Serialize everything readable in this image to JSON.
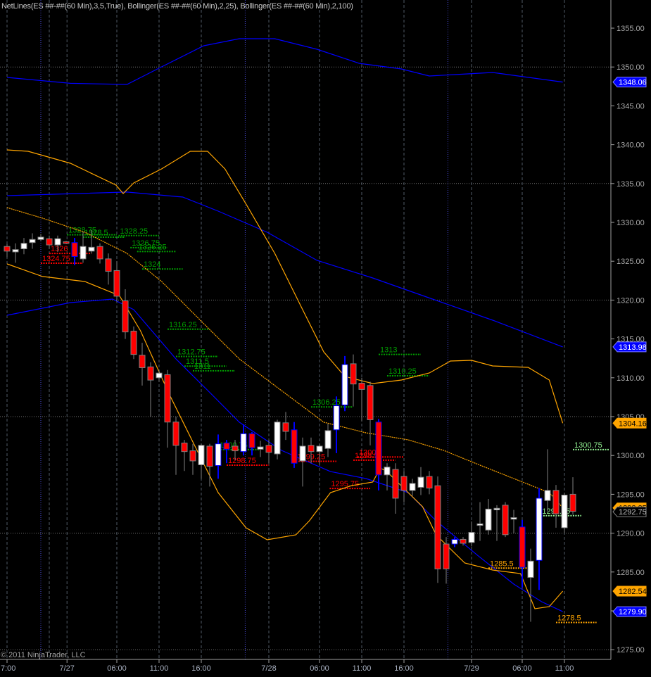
{
  "chart_data": {
    "type": "candlestick",
    "title": "NetLines(ES ##-##(60 Min),3,5,True), Bollinger(ES ##-##(60 Min),2,25), Bollinger(ES ##-##(60 Min),2,100)",
    "copyright": "© 2011 NinjaTrader, LLC",
    "ylim": [
      1273.4,
      1358.6
    ],
    "y_ticks": [
      1275,
      1280,
      1285,
      1290,
      1295,
      1300,
      1305,
      1310,
      1315,
      1320,
      1325,
      1330,
      1335,
      1340,
      1345,
      1350,
      1355
    ],
    "y_grid": [
      1275,
      1290,
      1305,
      1320,
      1335,
      1350
    ],
    "x_ticks": [
      {
        "bar": 0,
        "label": "7:00"
      },
      {
        "bar": 7.1,
        "label": "7/27"
      },
      {
        "bar": 13,
        "label": "06:00"
      },
      {
        "bar": 18,
        "label": "11:00"
      },
      {
        "bar": 23,
        "label": "16:00"
      },
      {
        "bar": 31,
        "label": "7/28"
      },
      {
        "bar": 37,
        "label": "06:00"
      },
      {
        "bar": 42,
        "label": "11:00"
      },
      {
        "bar": 47,
        "label": "16:00"
      },
      {
        "bar": 55,
        "label": "7/29"
      },
      {
        "bar": 61,
        "label": "06:00"
      },
      {
        "bar": 66,
        "label": "11:00"
      }
    ],
    "grid_bars": [
      0,
      5,
      7.1,
      13,
      18,
      23,
      31,
      37,
      42,
      47,
      55,
      61,
      66
    ],
    "session_bars": [
      4,
      28.2,
      52.2
    ],
    "colors": {
      "up": "#ffffff",
      "down": "#ff0000",
      "wick": "#808080",
      "signal": "#0000ff",
      "bb25": "#ffa500",
      "bb100": "#0000ff"
    },
    "candles": [
      [
        1326.9,
        1327.2,
        1325.5,
        1326.3,
        "d"
      ],
      [
        1326.2,
        1327.3,
        1324.8,
        1326.5,
        "u"
      ],
      [
        1326.6,
        1328.0,
        1325.9,
        1327.3,
        "u"
      ],
      [
        1327.4,
        1328.6,
        1326.6,
        1327.8,
        "u"
      ],
      [
        1327.8,
        1328.5,
        1327.6,
        1328.1,
        "u"
      ],
      [
        1327.9,
        1328.3,
        1326.6,
        1327.1,
        "d"
      ],
      [
        1327.1,
        1328.3,
        1326.2,
        1327.9,
        "u"
      ],
      [
        1327.5,
        1327.6,
        1327.2,
        1327.3,
        "d"
      ],
      [
        1327.4,
        1328.0,
        1324.5,
        1325.6,
        "bd"
      ],
      [
        1325.3,
        1328.8,
        1324.8,
        1326.9,
        "u"
      ],
      [
        1326.3,
        1329.0,
        1326.0,
        1326.8,
        "u"
      ],
      [
        1326.9,
        1327.3,
        1324.7,
        1325.3,
        "d"
      ],
      [
        1325.3,
        1326.0,
        1322.0,
        1323.7,
        "d"
      ],
      [
        1323.8,
        1325.0,
        1319.8,
        1320.5,
        "d"
      ],
      [
        1319.9,
        1321.4,
        1315.0,
        1315.9,
        "d"
      ],
      [
        1316.0,
        1316.6,
        1312.4,
        1313.0,
        "d"
      ],
      [
        1312.9,
        1314.5,
        1309.0,
        1311.3,
        "d"
      ],
      [
        1311.4,
        1312.0,
        1305.0,
        1309.7,
        "d"
      ],
      [
        1310.0,
        1311.0,
        1309.5,
        1310.6,
        "u"
      ],
      [
        1310.4,
        1311.0,
        1301.0,
        1304.3,
        "d"
      ],
      [
        1304.3,
        1305.0,
        1297.5,
        1301.3,
        "d"
      ],
      [
        1301.6,
        1302.0,
        1298.0,
        1300.5,
        "d"
      ],
      [
        1300.6,
        1301.5,
        1297.5,
        1299.3,
        "d"
      ],
      [
        1298.8,
        1301.5,
        1297.0,
        1301.3,
        "u"
      ],
      [
        1301.2,
        1301.5,
        1296.0,
        1298.6,
        "d"
      ],
      [
        1298.7,
        1302.7,
        1297.0,
        1301.5,
        "bu"
      ],
      [
        1301.6,
        1302.0,
        1299.0,
        1300.8,
        "bd"
      ],
      [
        1301.2,
        1302.0,
        1299.4,
        1300.6,
        "d"
      ],
      [
        1300.5,
        1304.0,
        1300.0,
        1302.8,
        "bu"
      ],
      [
        1302.8,
        1303.0,
        1300.0,
        1301.0,
        "bd"
      ],
      [
        1300.8,
        1301.9,
        1299.8,
        1301.1,
        "u"
      ],
      [
        1301.3,
        1302.0,
        1299.0,
        1300.4,
        "d"
      ],
      [
        1300.2,
        1304.6,
        1299.5,
        1304.3,
        "u"
      ],
      [
        1304.2,
        1305.6,
        1302.0,
        1303.1,
        "d"
      ],
      [
        1303.3,
        1304.3,
        1298.4,
        1299.0,
        "bd"
      ],
      [
        1299.3,
        1302.3,
        1296.0,
        1301.2,
        "u"
      ],
      [
        1301.3,
        1302.3,
        1299.0,
        1300.5,
        "d"
      ],
      [
        1300.5,
        1301.5,
        1298.8,
        1301.2,
        "u"
      ],
      [
        1300.9,
        1304.1,
        1299.8,
        1303.2,
        "u"
      ],
      [
        1303.3,
        1307.6,
        1300.3,
        1306.4,
        "bu"
      ],
      [
        1306.5,
        1312.8,
        1305.7,
        1311.7,
        "bu"
      ],
      [
        1311.8,
        1313.0,
        1306.3,
        1309.2,
        "d"
      ],
      [
        1309.3,
        1310.0,
        1304.4,
        1308.5,
        "d"
      ],
      [
        1309.0,
        1309.5,
        1301.3,
        1304.6,
        "d"
      ],
      [
        1304.3,
        1304.7,
        1295.5,
        1297.5,
        "bd"
      ],
      [
        1297.5,
        1299.0,
        1295.5,
        1298.5,
        "u"
      ],
      [
        1298.2,
        1299.0,
        1292.5,
        1294.5,
        "d"
      ],
      [
        1297.3,
        1298.0,
        1294.0,
        1295.5,
        "d"
      ],
      [
        1295.5,
        1297.0,
        1294.8,
        1296.4,
        "u"
      ],
      [
        1295.9,
        1298.5,
        1294.9,
        1297.2,
        "u"
      ],
      [
        1297.3,
        1298.0,
        1295.0,
        1295.8,
        "d"
      ],
      [
        1296.1,
        1297.3,
        1283.6,
        1285.4,
        "d"
      ],
      [
        1288.6,
        1289.5,
        1283.5,
        1285.4,
        "d"
      ],
      [
        1288.6,
        1289.5,
        1288.2,
        1289.2,
        "bu"
      ],
      [
        1289.2,
        1289.5,
        1288.4,
        1288.7,
        "d"
      ],
      [
        1288.8,
        1291.5,
        1288.3,
        1290.1,
        "u"
      ],
      [
        1291.0,
        1294.0,
        1289.0,
        1291.2,
        "u"
      ],
      [
        1290.4,
        1294.4,
        1289.8,
        1293.1,
        "u"
      ],
      [
        1293.0,
        1293.6,
        1289.0,
        1293.2,
        "u"
      ],
      [
        1293.6,
        1294.0,
        1289.5,
        1289.8,
        "d"
      ],
      [
        1291.8,
        1293.0,
        1290.0,
        1292.0,
        "u"
      ],
      [
        1290.8,
        1291.7,
        1283.0,
        1285.6,
        "bd"
      ],
      [
        1284.3,
        1288.0,
        1278.6,
        1286.4,
        "u"
      ],
      [
        1286.5,
        1295.8,
        1282.7,
        1294.5,
        "bu"
      ],
      [
        1294.2,
        1300.8,
        1292.8,
        1295.5,
        "u"
      ],
      [
        1295.5,
        1296.2,
        1290.7,
        1292.5,
        "d"
      ],
      [
        1290.7,
        1295.2,
        1290.0,
        1294.9,
        "u"
      ],
      [
        1295.0,
        1297.2,
        1292.4,
        1292.8,
        "d"
      ]
    ],
    "series": [
      {
        "name": "Bollinger(100) upper",
        "color": "#0000ff",
        "dash": "",
        "points": [
          [
            0,
            1348.66
          ],
          [
            7.5,
            1347.9
          ],
          [
            14.2,
            1347.75
          ],
          [
            18.3,
            1350.02
          ],
          [
            23.3,
            1352.74
          ],
          [
            27.5,
            1353.64
          ],
          [
            31.7,
            1353.64
          ],
          [
            36.7,
            1352.28
          ],
          [
            41.7,
            1350.47
          ],
          [
            46.7,
            1349.75
          ],
          [
            50,
            1348.84
          ],
          [
            57.5,
            1349.29
          ],
          [
            65.8,
            1348.06
          ]
        ]
      },
      {
        "name": "Bollinger(100) middle",
        "color": "#0000ff",
        "dash": "",
        "points": [
          [
            0,
            1333.44
          ],
          [
            14.2,
            1333.9
          ],
          [
            20.8,
            1333.26
          ],
          [
            25,
            1331.45
          ],
          [
            30.8,
            1328.73
          ],
          [
            36.7,
            1325.11
          ],
          [
            43.3,
            1322.84
          ],
          [
            49.2,
            1320.58
          ],
          [
            57.5,
            1317.41
          ],
          [
            65.8,
            1313.98
          ]
        ]
      },
      {
        "name": "Bollinger(100) lower",
        "color": "#0000ff",
        "dash": "",
        "points": [
          [
            0,
            1318.04
          ],
          [
            7.5,
            1319.67
          ],
          [
            12.5,
            1320.13
          ],
          [
            15,
            1318.77
          ],
          [
            20,
            1312.43
          ],
          [
            24.2,
            1307.9
          ],
          [
            27.5,
            1304.28
          ],
          [
            32.5,
            1300.65
          ],
          [
            38.3,
            1297.93
          ],
          [
            42.5,
            1297.03
          ],
          [
            47.5,
            1295.22
          ],
          [
            50.8,
            1291.59
          ],
          [
            55.8,
            1287.07
          ],
          [
            60,
            1283.44
          ],
          [
            63.3,
            1281.18
          ],
          [
            65.8,
            1279.9
          ]
        ]
      },
      {
        "name": "Bollinger(25) upper",
        "color": "#ffa500",
        "dash": "",
        "points": [
          [
            0,
            1339.33
          ],
          [
            2.5,
            1339.15
          ],
          [
            7.5,
            1337.61
          ],
          [
            12.9,
            1334.8
          ],
          [
            13.75,
            1333.71
          ],
          [
            15,
            1335.07
          ],
          [
            18.3,
            1336.88
          ],
          [
            21.7,
            1339.15
          ],
          [
            23.75,
            1339.15
          ],
          [
            25.8,
            1336.88
          ],
          [
            28.3,
            1332.36
          ],
          [
            31.7,
            1326.01
          ],
          [
            35,
            1318.77
          ],
          [
            37.5,
            1313.33
          ],
          [
            40,
            1310.16
          ],
          [
            43.3,
            1309.26
          ],
          [
            46.7,
            1309.71
          ],
          [
            50,
            1310.62
          ],
          [
            52.5,
            1312.16
          ],
          [
            55,
            1312.25
          ],
          [
            57.5,
            1311.52
          ],
          [
            61.7,
            1311.34
          ],
          [
            64.2,
            1309.71
          ],
          [
            65.8,
            1304.16
          ]
        ]
      },
      {
        "name": "Bollinger(25) middle",
        "color": "#ffa500",
        "dash": "2,1",
        "points": [
          [
            0,
            1331.9
          ],
          [
            4.2,
            1330.54
          ],
          [
            9.2,
            1328.73
          ],
          [
            14.2,
            1326.01
          ],
          [
            18.3,
            1322.39
          ],
          [
            23.3,
            1316.96
          ],
          [
            27.5,
            1312.43
          ],
          [
            32.5,
            1308.35
          ],
          [
            37.5,
            1304.28
          ],
          [
            42.5,
            1302.92
          ],
          [
            47.5,
            1302.01
          ],
          [
            51.7,
            1300.65
          ],
          [
            55.8,
            1298.84
          ],
          [
            60,
            1297.03
          ],
          [
            64.2,
            1295.22
          ],
          [
            65.8,
            1293.25
          ]
        ]
      },
      {
        "name": "Bollinger(25) lower",
        "color": "#ffa500",
        "dash": "",
        "points": [
          [
            0,
            1324.66
          ],
          [
            4.2,
            1323.03
          ],
          [
            9.2,
            1322.39
          ],
          [
            13.3,
            1320.58
          ],
          [
            15.8,
            1316.05
          ],
          [
            19.2,
            1307.9
          ],
          [
            22.5,
            1300.65
          ],
          [
            25,
            1295.22
          ],
          [
            28.3,
            1290.69
          ],
          [
            30.8,
            1289.15
          ],
          [
            34.2,
            1289.78
          ],
          [
            35.8,
            1291.59
          ],
          [
            38.3,
            1295.22
          ],
          [
            40.8,
            1296.12
          ],
          [
            43.3,
            1296.58
          ],
          [
            44.2,
            1298.39
          ],
          [
            45,
            1297.93
          ],
          [
            45.8,
            1297.03
          ],
          [
            49.2,
            1293.41
          ],
          [
            50.8,
            1289.78
          ],
          [
            54.2,
            1286.16
          ],
          [
            57.5,
            1285.25
          ],
          [
            60.8,
            1284.8
          ],
          [
            62.5,
            1280.27
          ],
          [
            64.2,
            1280.54
          ],
          [
            65.8,
            1282.54
          ]
        ]
      }
    ],
    "levels": [
      {
        "label": "1328.75",
        "price": 1328.4,
        "from": 7.1,
        "to": 13,
        "color": "#00a000"
      },
      {
        "label": "1328.5",
        "price": 1328.1,
        "from": 9,
        "to": 14,
        "color": "#00a000"
      },
      {
        "label": "1328.25",
        "price": 1328.3,
        "from": 13.2,
        "to": 18,
        "color": "#00a000"
      },
      {
        "label": "1326.75",
        "price": 1326.75,
        "from": 14.6,
        "to": 19,
        "color": "#00a000"
      },
      {
        "label": "1326.25",
        "price": 1326.25,
        "from": 15.4,
        "to": 20,
        "color": "#00a000"
      },
      {
        "label": "1324",
        "price": 1324,
        "from": 16,
        "to": 20.8,
        "color": "#00a000"
      },
      {
        "label": "1316.25",
        "price": 1316.25,
        "from": 19,
        "to": 24,
        "color": "#00a000"
      },
      {
        "label": "1312.75",
        "price": 1312.75,
        "from": 20,
        "to": 25,
        "color": "#00a000"
      },
      {
        "label": "1311.5",
        "price": 1311.5,
        "from": 21,
        "to": 26,
        "color": "#00a000"
      },
      {
        "label": "1311",
        "price": 1310.9,
        "from": 22,
        "to": 27,
        "color": "#00a000"
      },
      {
        "label": "1313",
        "price": 1313,
        "from": 44,
        "to": 49,
        "color": "#00a000"
      },
      {
        "label": "1310.25",
        "price": 1310.25,
        "from": 45,
        "to": 50,
        "color": "#00a000"
      },
      {
        "label": "1306.25",
        "price": 1306.25,
        "from": 36,
        "to": 41,
        "color": "#00a000"
      },
      {
        "label": "1300.75",
        "price": 1300.75,
        "from": 25,
        "to": 30,
        "color": "#00a000"
      },
      {
        "label": "1300.75",
        "price": 1300.75,
        "from": 67,
        "to": 71.3,
        "color": "#90ee90"
      },
      {
        "label": "1292.25",
        "price": 1292.25,
        "from": 63.2,
        "to": 68,
        "color": "#90ee90"
      },
      {
        "label": "1326",
        "price": 1326,
        "from": 5,
        "to": 10,
        "color": "#ff0000"
      },
      {
        "label": "1324.75",
        "price": 1324.75,
        "from": 4,
        "to": 9,
        "color": "#ff0000"
      },
      {
        "label": "1298.75",
        "price": 1298.75,
        "from": 26,
        "to": 31,
        "color": "#ff0000"
      },
      {
        "label": "1299.25",
        "price": 1299.25,
        "from": 34.2,
        "to": 39,
        "color": "#ff0000"
      },
      {
        "label": "1300",
        "price": 1299.8,
        "from": 41.5,
        "to": 47,
        "color": "#ff0000"
      },
      {
        "label": "1298.5",
        "price": 1299.4,
        "from": 41,
        "to": 46,
        "color": "#ff0000"
      },
      {
        "label": "1295.75",
        "price": 1295.75,
        "from": 38.2,
        "to": 43,
        "color": "#ff0000"
      },
      {
        "label": "1285.5",
        "price": 1285.5,
        "from": 57,
        "to": 61.7,
        "color": "#ffa500"
      },
      {
        "label": "1278.5",
        "price": 1278.5,
        "from": 65,
        "to": 69.8,
        "color": "#ffa500"
      }
    ],
    "price_markers": [
      {
        "label": "1348.06",
        "price": 1348.06,
        "bg": "#0000ff",
        "fg": "#ffffff",
        "border": "#8080ff"
      },
      {
        "label": "1313.98",
        "price": 1313.98,
        "bg": "#0000ff",
        "fg": "#ffffff",
        "border": "#8080ff"
      },
      {
        "label": "1304.16",
        "price": 1304.16,
        "bg": "#ffa500",
        "fg": "#000000",
        "border": "#ffa500"
      },
      {
        "label": "1293.25",
        "price": 1293.25,
        "bg": "#ffa500",
        "fg": "#000000",
        "border": "#ffa500"
      },
      {
        "label": "1292.75",
        "price": 1292.75,
        "bg": "#000000",
        "fg": "#c0c0c0",
        "border": "#808080"
      },
      {
        "label": "1282.54",
        "price": 1282.54,
        "bg": "#ffa500",
        "fg": "#000000",
        "border": "#ffa500"
      },
      {
        "label": "1279.90",
        "price": 1279.9,
        "bg": "#0000ff",
        "fg": "#ffffff",
        "border": "#8080ff"
      }
    ]
  }
}
